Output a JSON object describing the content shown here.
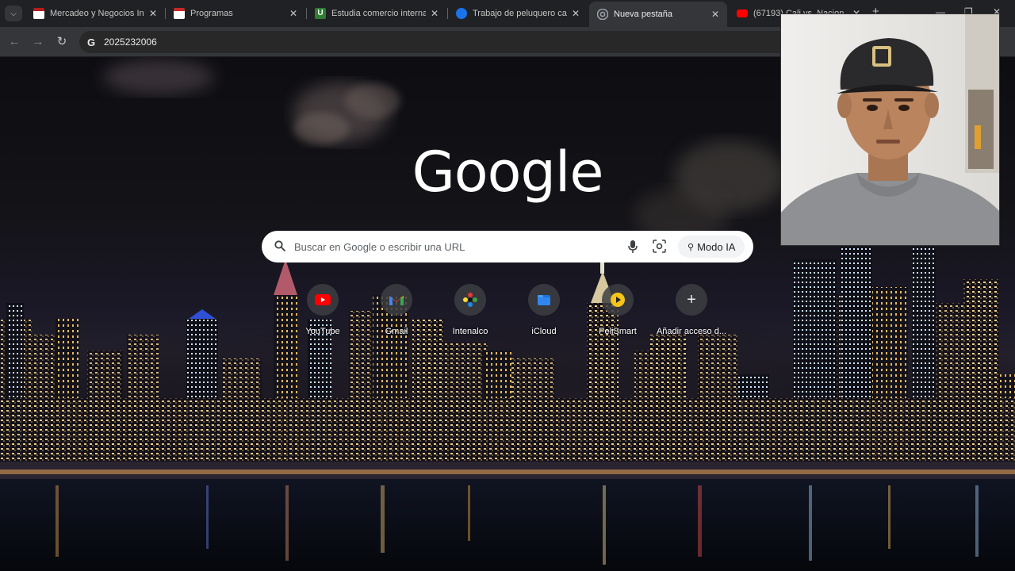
{
  "browser": {
    "tabs": [
      {
        "title": "Mercadeo y Negocios Inte",
        "favicon_color": "#b71c1c",
        "active": false
      },
      {
        "title": "Programas",
        "favicon_color": "#c62828",
        "active": false
      },
      {
        "title": "Estudia comercio internaci",
        "favicon_color": "#2e7d32",
        "active": false
      },
      {
        "title": "Trabajo de peluquero canin",
        "favicon_color": "#1a73e8",
        "active": false
      },
      {
        "title": "Nueva pestaña",
        "favicon_color": "#9aa0a6",
        "active": true
      },
      {
        "title": "(67193) Cali vs. Nacion",
        "favicon_color": "#ff0000",
        "active": false
      }
    ],
    "address_bar": {
      "value": "2025232006"
    },
    "colors": {
      "frame": "#202124",
      "toolbar": "#35363a",
      "omnibox": "#282828"
    }
  },
  "ntp": {
    "logo_text": "Google",
    "search": {
      "placeholder": "Buscar en Google o escribir una URL",
      "ai_mode_label": "Modo IA"
    },
    "shortcuts": [
      {
        "label": "YouTube",
        "icon": "youtube-icon"
      },
      {
        "label": "Gmail",
        "icon": "gmail-icon"
      },
      {
        "label": "Intenalco",
        "icon": "intenalco-icon"
      },
      {
        "label": "iCloud",
        "icon": "icloud-icon"
      },
      {
        "label": "PeliSmart",
        "icon": "pelismart-icon"
      },
      {
        "label": "Añadir acceso d...",
        "icon": "plus-icon"
      }
    ]
  },
  "overlay": {
    "type": "webcam",
    "description_icon": "person-webcam-feed"
  }
}
